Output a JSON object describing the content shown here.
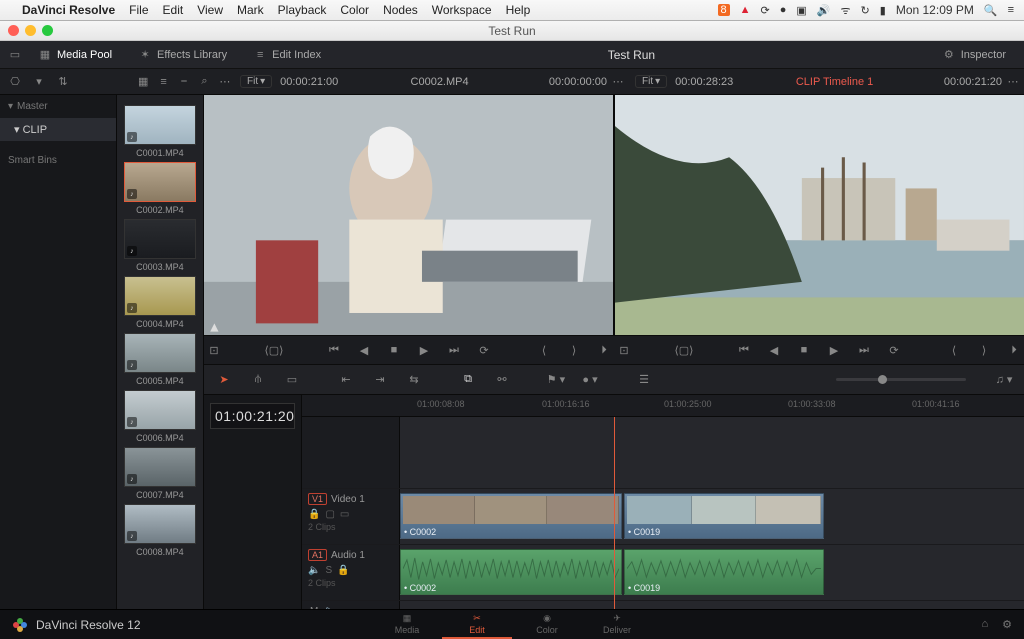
{
  "os": {
    "app_name": "DaVinci Resolve",
    "menus": [
      "File",
      "Edit",
      "View",
      "Mark",
      "Playback",
      "Color",
      "Nodes",
      "Workspace",
      "Help"
    ],
    "clock": "Mon 12:09 PM",
    "window_title": "Test Run"
  },
  "topbar": {
    "media_pool": "Media Pool",
    "effects_library": "Effects Library",
    "edit_index": "Edit Index",
    "project_title": "Test Run",
    "inspector": "Inspector"
  },
  "subbar": {
    "src_fit": "Fit",
    "src_tc": "00:00:21:00",
    "src_name": "C0002.MP4",
    "src_dur": "00:00:00:00",
    "tl_fit": "Fit",
    "tl_tc": "00:00:28:23",
    "tl_name": "CLIP Timeline 1",
    "tl_dur": "00:00:21:20"
  },
  "sidebar": {
    "master": "Master",
    "clip": "CLIP",
    "smart_bins": "Smart Bins"
  },
  "pool": {
    "clips": [
      {
        "name": "C0001.MP4"
      },
      {
        "name": "C0002.MP4"
      },
      {
        "name": "C0003.MP4"
      },
      {
        "name": "C0004.MP4"
      },
      {
        "name": "C0005.MP4"
      },
      {
        "name": "C0006.MP4"
      },
      {
        "name": "C0007.MP4"
      },
      {
        "name": "C0008.MP4"
      }
    ]
  },
  "timeline": {
    "master_tc": "01:00:21:20",
    "ruler": [
      "01:00:08:08",
      "01:00:16:16",
      "01:00:25:00",
      "01:00:33:08",
      "01:00:41:16"
    ],
    "v1": {
      "tag": "V1",
      "label": "Video 1",
      "clip_count": "2 Clips"
    },
    "a1": {
      "tag": "A1",
      "label": "Audio 1",
      "clip_count": "2 Clips"
    },
    "m": "M",
    "clips_v": [
      {
        "name": "• C0002"
      },
      {
        "name": "• C0019"
      }
    ],
    "clips_a": [
      {
        "name": "• C0002"
      },
      {
        "name": "• C0019"
      }
    ]
  },
  "bottom": {
    "brand": "DaVinci Resolve 12",
    "tabs": [
      "Media",
      "Edit",
      "Color",
      "Deliver"
    ]
  },
  "colors": {
    "accent": "#e05a3a",
    "video_clip": "#5a7a96",
    "audio_clip": "#4a9060"
  }
}
